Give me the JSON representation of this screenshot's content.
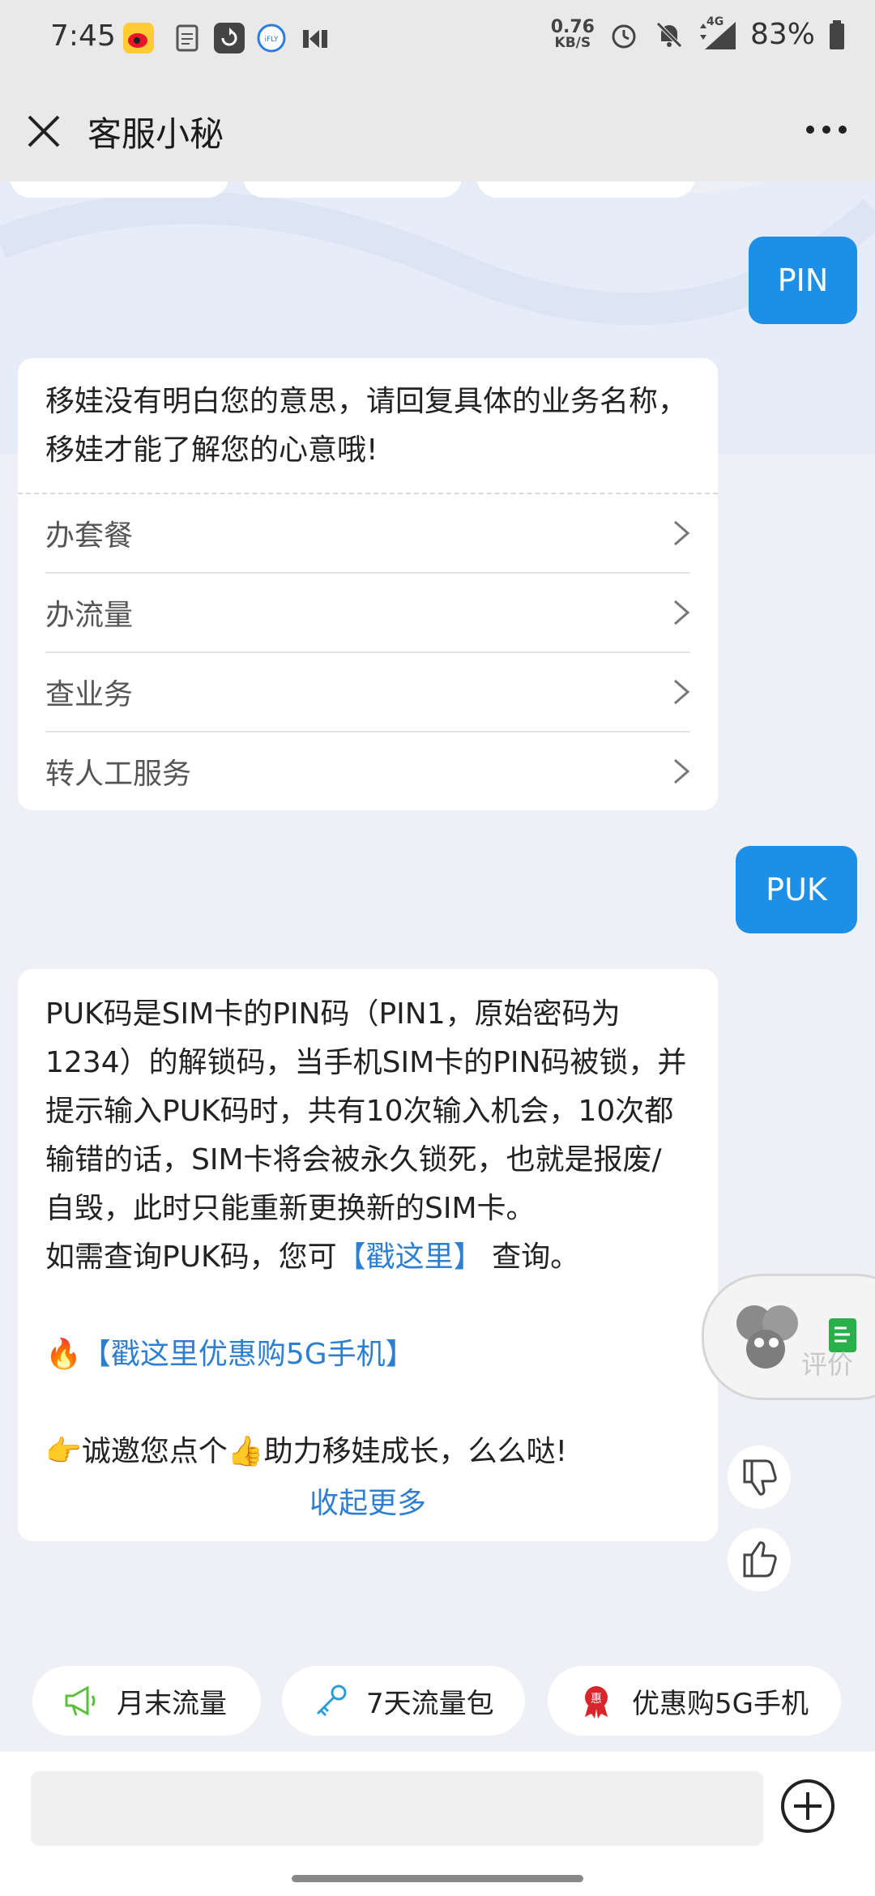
{
  "status_bar": {
    "time": "7:45",
    "net_speed_value": "0.76",
    "net_speed_unit": "KB/S",
    "network": "4G",
    "battery": "83%"
  },
  "header": {
    "title": "客服小秘"
  },
  "messages": {
    "user_1": "PIN",
    "bot_1": {
      "text": "移娃没有明白您的意思，请回复具体的业务名称，移娃才能了解您的心意哦!",
      "options": [
        "办套餐",
        "办流量",
        "查业务",
        "转人工服务"
      ]
    },
    "user_2": "PUK",
    "bot_2": {
      "paragraph": "PUK码是SIM卡的PIN码（PIN1，原始密码为1234）的解锁码，当手机SIM卡的PIN码被锁，并提示输入PUK码时，共有10次输入机会，10次都输错的话，SIM卡将会被永久锁死，也就是报废/自毁，此时只能重新更换新的SIM卡。",
      "query_prefix": "如需查询PUK码，您可",
      "query_link": "【戳这里】",
      "query_suffix": " 查询。",
      "promo_emoji": "🔥",
      "promo_link": "【戳这里优惠购5G手机】",
      "invite_emoji_1": "👉",
      "invite_text_1": "诚邀您点个",
      "invite_emoji_2": "👍",
      "invite_text_2": "助力移娃成长，么么哒!",
      "collapse": "收起更多"
    }
  },
  "floating_widget": {
    "label": "评价"
  },
  "shortcuts": [
    {
      "label": "月末流量",
      "icon": "megaphone-icon"
    },
    {
      "label": "7天流量包",
      "icon": "key-icon"
    },
    {
      "label": "优惠购5G手机",
      "icon": "discount-badge-icon"
    }
  ],
  "colors": {
    "accent": "#1d8fe6",
    "link": "#2f7fd1"
  }
}
